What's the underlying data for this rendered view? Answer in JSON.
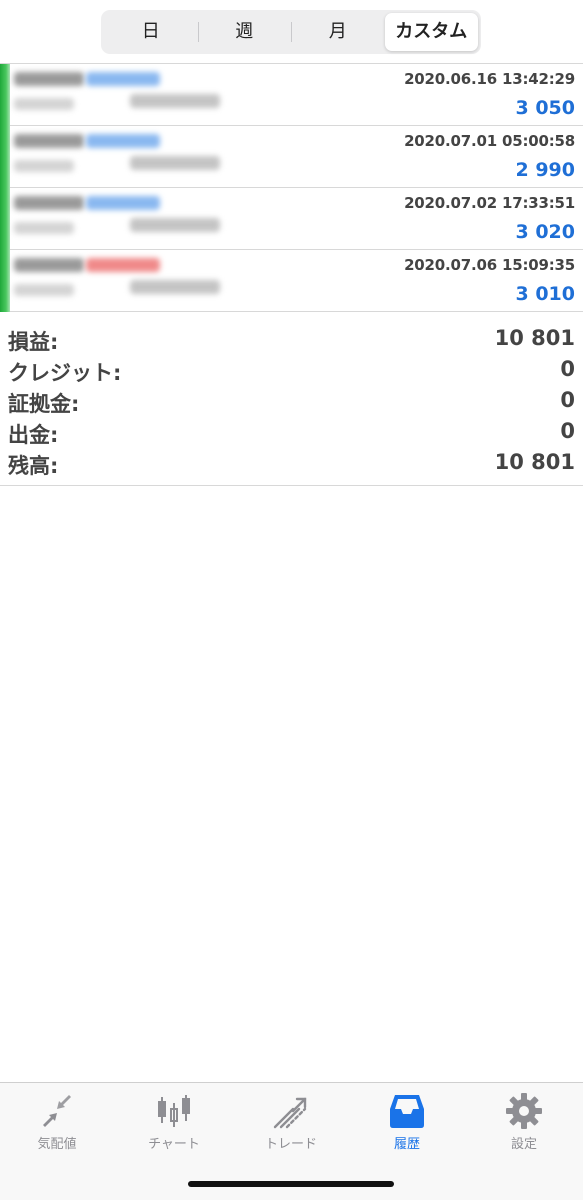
{
  "period_tabs": [
    {
      "label": "日",
      "active": false
    },
    {
      "label": "週",
      "active": false
    },
    {
      "label": "月",
      "active": false
    },
    {
      "label": "カスタム",
      "active": true
    }
  ],
  "deals": [
    {
      "time": "2020.06.16 13:42:29",
      "profit": "3 050",
      "type_color": "#8ab8f0"
    },
    {
      "time": "2020.07.01 05:00:58",
      "profit": "2 990",
      "type_color": "#8ab8f0"
    },
    {
      "time": "2020.07.02 17:33:51",
      "profit": "3 020",
      "type_color": "#8ab8f0"
    },
    {
      "time": "2020.07.06 15:09:35",
      "profit": "3 010",
      "type_color": "#f08a8a"
    }
  ],
  "summary": [
    {
      "label": "損益:",
      "value": "10 801"
    },
    {
      "label": "クレジット:",
      "value": "0"
    },
    {
      "label": "証拠金:",
      "value": "0"
    },
    {
      "label": "出金:",
      "value": "0"
    },
    {
      "label": "残高:",
      "value": "10 801"
    }
  ],
  "tabbar": [
    {
      "label": "気配値",
      "icon": "quotes-icon",
      "active": false
    },
    {
      "label": "チャート",
      "icon": "chart-icon",
      "active": false
    },
    {
      "label": "トレード",
      "icon": "trade-icon",
      "active": false
    },
    {
      "label": "履歴",
      "icon": "history-icon",
      "active": true
    },
    {
      "label": "設定",
      "icon": "settings-icon",
      "active": false
    }
  ],
  "colors": {
    "profit": "#1f6fd6",
    "active_tab": "#1a73e8",
    "inactive_tab": "#8e8e93"
  }
}
